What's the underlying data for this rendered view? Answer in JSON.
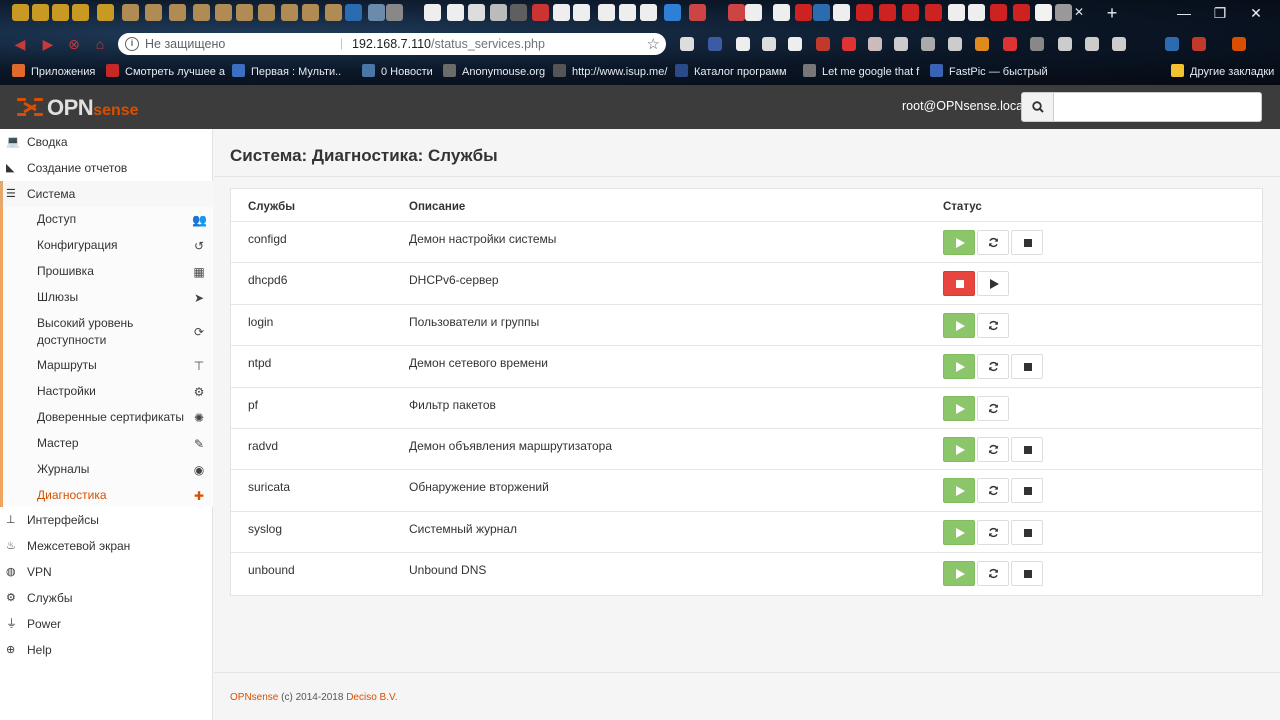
{
  "browser": {
    "not_secure_label": "Не защищено",
    "url_host": "192.168.7.110",
    "url_path": "/status_services.php",
    "bookmarks": [
      {
        "label": "Приложения",
        "icon": "apps-grid-icon",
        "color": "#e06a2c"
      },
      {
        "label": "Смотреть лучшее а",
        "icon": "red-bookmark-icon",
        "color": "#c62828"
      },
      {
        "label": "Первая : Мульти..",
        "icon": "blue-bookmark-icon",
        "color": "#3b6fc4"
      },
      {
        "label": "0 Новости",
        "icon": "vk-icon",
        "color": "#4a76a8"
      },
      {
        "label": "Anonymouse.org",
        "icon": "mask-icon",
        "color": "#6b6b6b"
      },
      {
        "label": "http://www.isup.me/",
        "icon": "page-icon",
        "color": "#555555"
      },
      {
        "label": "Каталог программ",
        "icon": "number-4-icon",
        "color": "#2a4a8a"
      },
      {
        "label": "Let me google that f",
        "icon": "lmgtfy-icon",
        "color": "#777777"
      },
      {
        "label": "FastPic — быстрый",
        "icon": "fastpic-icon",
        "color": "#3a63b5"
      },
      {
        "label": "Другие закладки",
        "icon": "folder-icon",
        "color": "#f2c230"
      }
    ]
  },
  "header": {
    "brand_prefix": "OPN",
    "brand_suffix": "sense",
    "user": "root@OPNsense.local",
    "search_placeholder": ""
  },
  "sidebar": {
    "top_items": [
      {
        "label": "Сводка",
        "icon": "laptop-icon"
      },
      {
        "label": "Создание отчетов",
        "icon": "area-chart-icon"
      },
      {
        "label": "Система",
        "icon": "server-icon"
      }
    ],
    "system_items": [
      {
        "label": "Доступ",
        "icon": "users-icon"
      },
      {
        "label": "Конфигурация",
        "icon": "history-icon"
      },
      {
        "label": "Прошивка",
        "icon": "building-icon"
      },
      {
        "label": "Шлюзы",
        "icon": "location-arrow-icon"
      },
      {
        "label": "Высокий уровень доступности",
        "icon": "refresh-icon"
      },
      {
        "label": "Маршруты",
        "icon": "signpost-icon"
      },
      {
        "label": "Настройки",
        "icon": "cogs-icon"
      },
      {
        "label": "Доверенные сертификаты",
        "icon": "certificate-icon"
      },
      {
        "label": "Мастер",
        "icon": "magic-icon"
      },
      {
        "label": "Журналы",
        "icon": "eye-icon"
      },
      {
        "label": "Диагностика",
        "icon": "medkit-icon"
      }
    ],
    "bottom_items": [
      {
        "label": "Интерфейсы",
        "icon": "sitemap-icon"
      },
      {
        "label": "Межсетевой экран",
        "icon": "fire-icon"
      },
      {
        "label": "VPN",
        "icon": "globe-icon"
      },
      {
        "label": "Службы",
        "icon": "cog-icon"
      },
      {
        "label": "Power",
        "icon": "plug-icon"
      },
      {
        "label": "Help",
        "icon": "lifebuoy-icon"
      }
    ]
  },
  "page": {
    "title": "Система: Диагностика: Службы",
    "columns": [
      "Службы",
      "Описание",
      "Статус"
    ],
    "services": [
      {
        "name": "configd",
        "description": "Демон настройки системы",
        "running": true,
        "restart": true,
        "stop": true
      },
      {
        "name": "dhcpd6",
        "description": "DHCPv6-сервер",
        "running": false,
        "restart": false,
        "stop": false
      },
      {
        "name": "login",
        "description": "Пользователи и группы",
        "running": true,
        "restart": true,
        "stop": false
      },
      {
        "name": "ntpd",
        "description": "Демон сетевого времени",
        "running": true,
        "restart": true,
        "stop": true
      },
      {
        "name": "pf",
        "description": "Фильтр пакетов",
        "running": true,
        "restart": true,
        "stop": false
      },
      {
        "name": "radvd",
        "description": "Демон объявления маршрутизатора",
        "running": true,
        "restart": true,
        "stop": true
      },
      {
        "name": "suricata",
        "description": "Обнаружение вторжений",
        "running": true,
        "restart": true,
        "stop": true
      },
      {
        "name": "syslog",
        "description": "Системный журнал",
        "running": true,
        "restart": true,
        "stop": true
      },
      {
        "name": "unbound",
        "description": "Unbound DNS",
        "running": true,
        "restart": true,
        "stop": true
      }
    ],
    "colors": {
      "running": "#8bc66b",
      "stopped": "#e9453f",
      "accent": "#d94f00"
    }
  },
  "footer": {
    "brand": "OPNsense",
    "copyright": "(c) 2014-2018",
    "company": "Deciso B.V."
  }
}
